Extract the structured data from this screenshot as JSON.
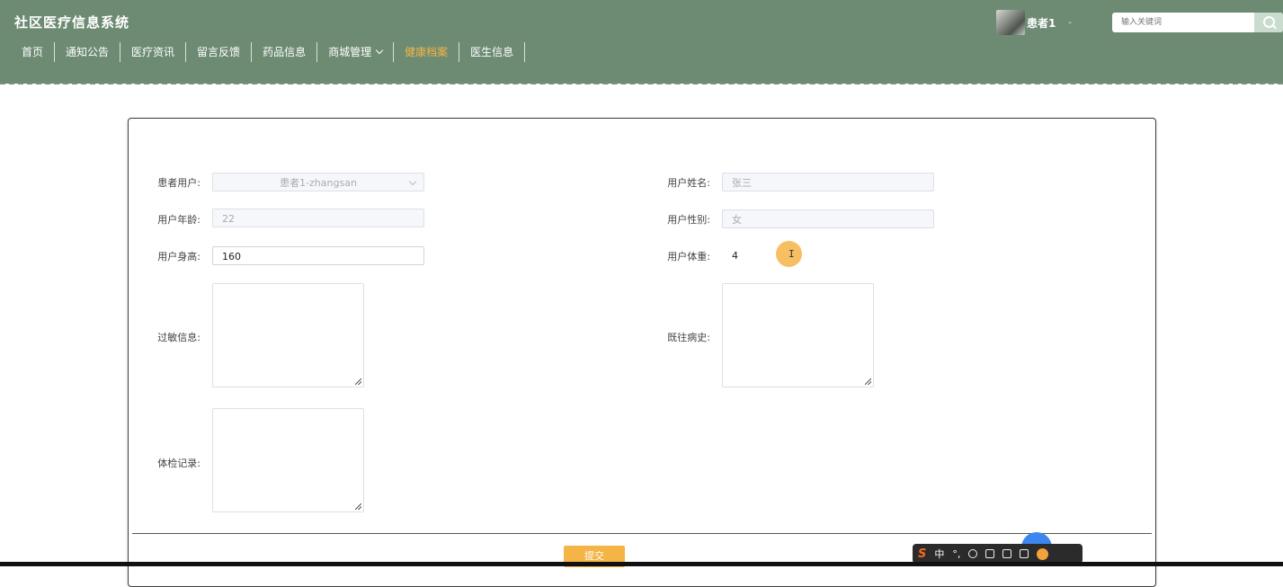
{
  "header": {
    "site_title": "社区医疗信息系统",
    "nav": [
      {
        "label": "首页",
        "active": false
      },
      {
        "label": "通知公告",
        "active": false
      },
      {
        "label": "医疗资讯",
        "active": false
      },
      {
        "label": "留言反馈",
        "active": false
      },
      {
        "label": "药品信息",
        "active": false
      },
      {
        "label": "商城管理",
        "active": false,
        "has_dropdown": true
      },
      {
        "label": "健康档案",
        "active": true
      },
      {
        "label": "医生信息",
        "active": false
      }
    ],
    "user": {
      "name": "患者1",
      "caret": "-"
    },
    "search": {
      "placeholder": "输入关键词",
      "icon": "search-icon"
    },
    "colors": {
      "background": "#6d8b73",
      "active_nav": "#f4b446"
    }
  },
  "form": {
    "patient_user": {
      "label": "患者用户:",
      "value": "患者1-zhangsan"
    },
    "user_name": {
      "label": "用户姓名:",
      "value": "张三"
    },
    "user_age": {
      "label": "用户年龄:",
      "value": "22"
    },
    "user_gender": {
      "label": "用户性别:",
      "value": "女"
    },
    "user_height": {
      "label": "用户身高:",
      "value": "160"
    },
    "user_weight": {
      "label": "用户体重:",
      "value": "4"
    },
    "allergy_info": {
      "label": "过敏信息:",
      "value": ""
    },
    "medical_history": {
      "label": "既往病史:",
      "value": ""
    },
    "checkup_record": {
      "label": "体检记录:",
      "value": ""
    },
    "submit_label": "提交"
  },
  "ime_toolbar": {
    "mode": "中",
    "punct": "°,"
  }
}
